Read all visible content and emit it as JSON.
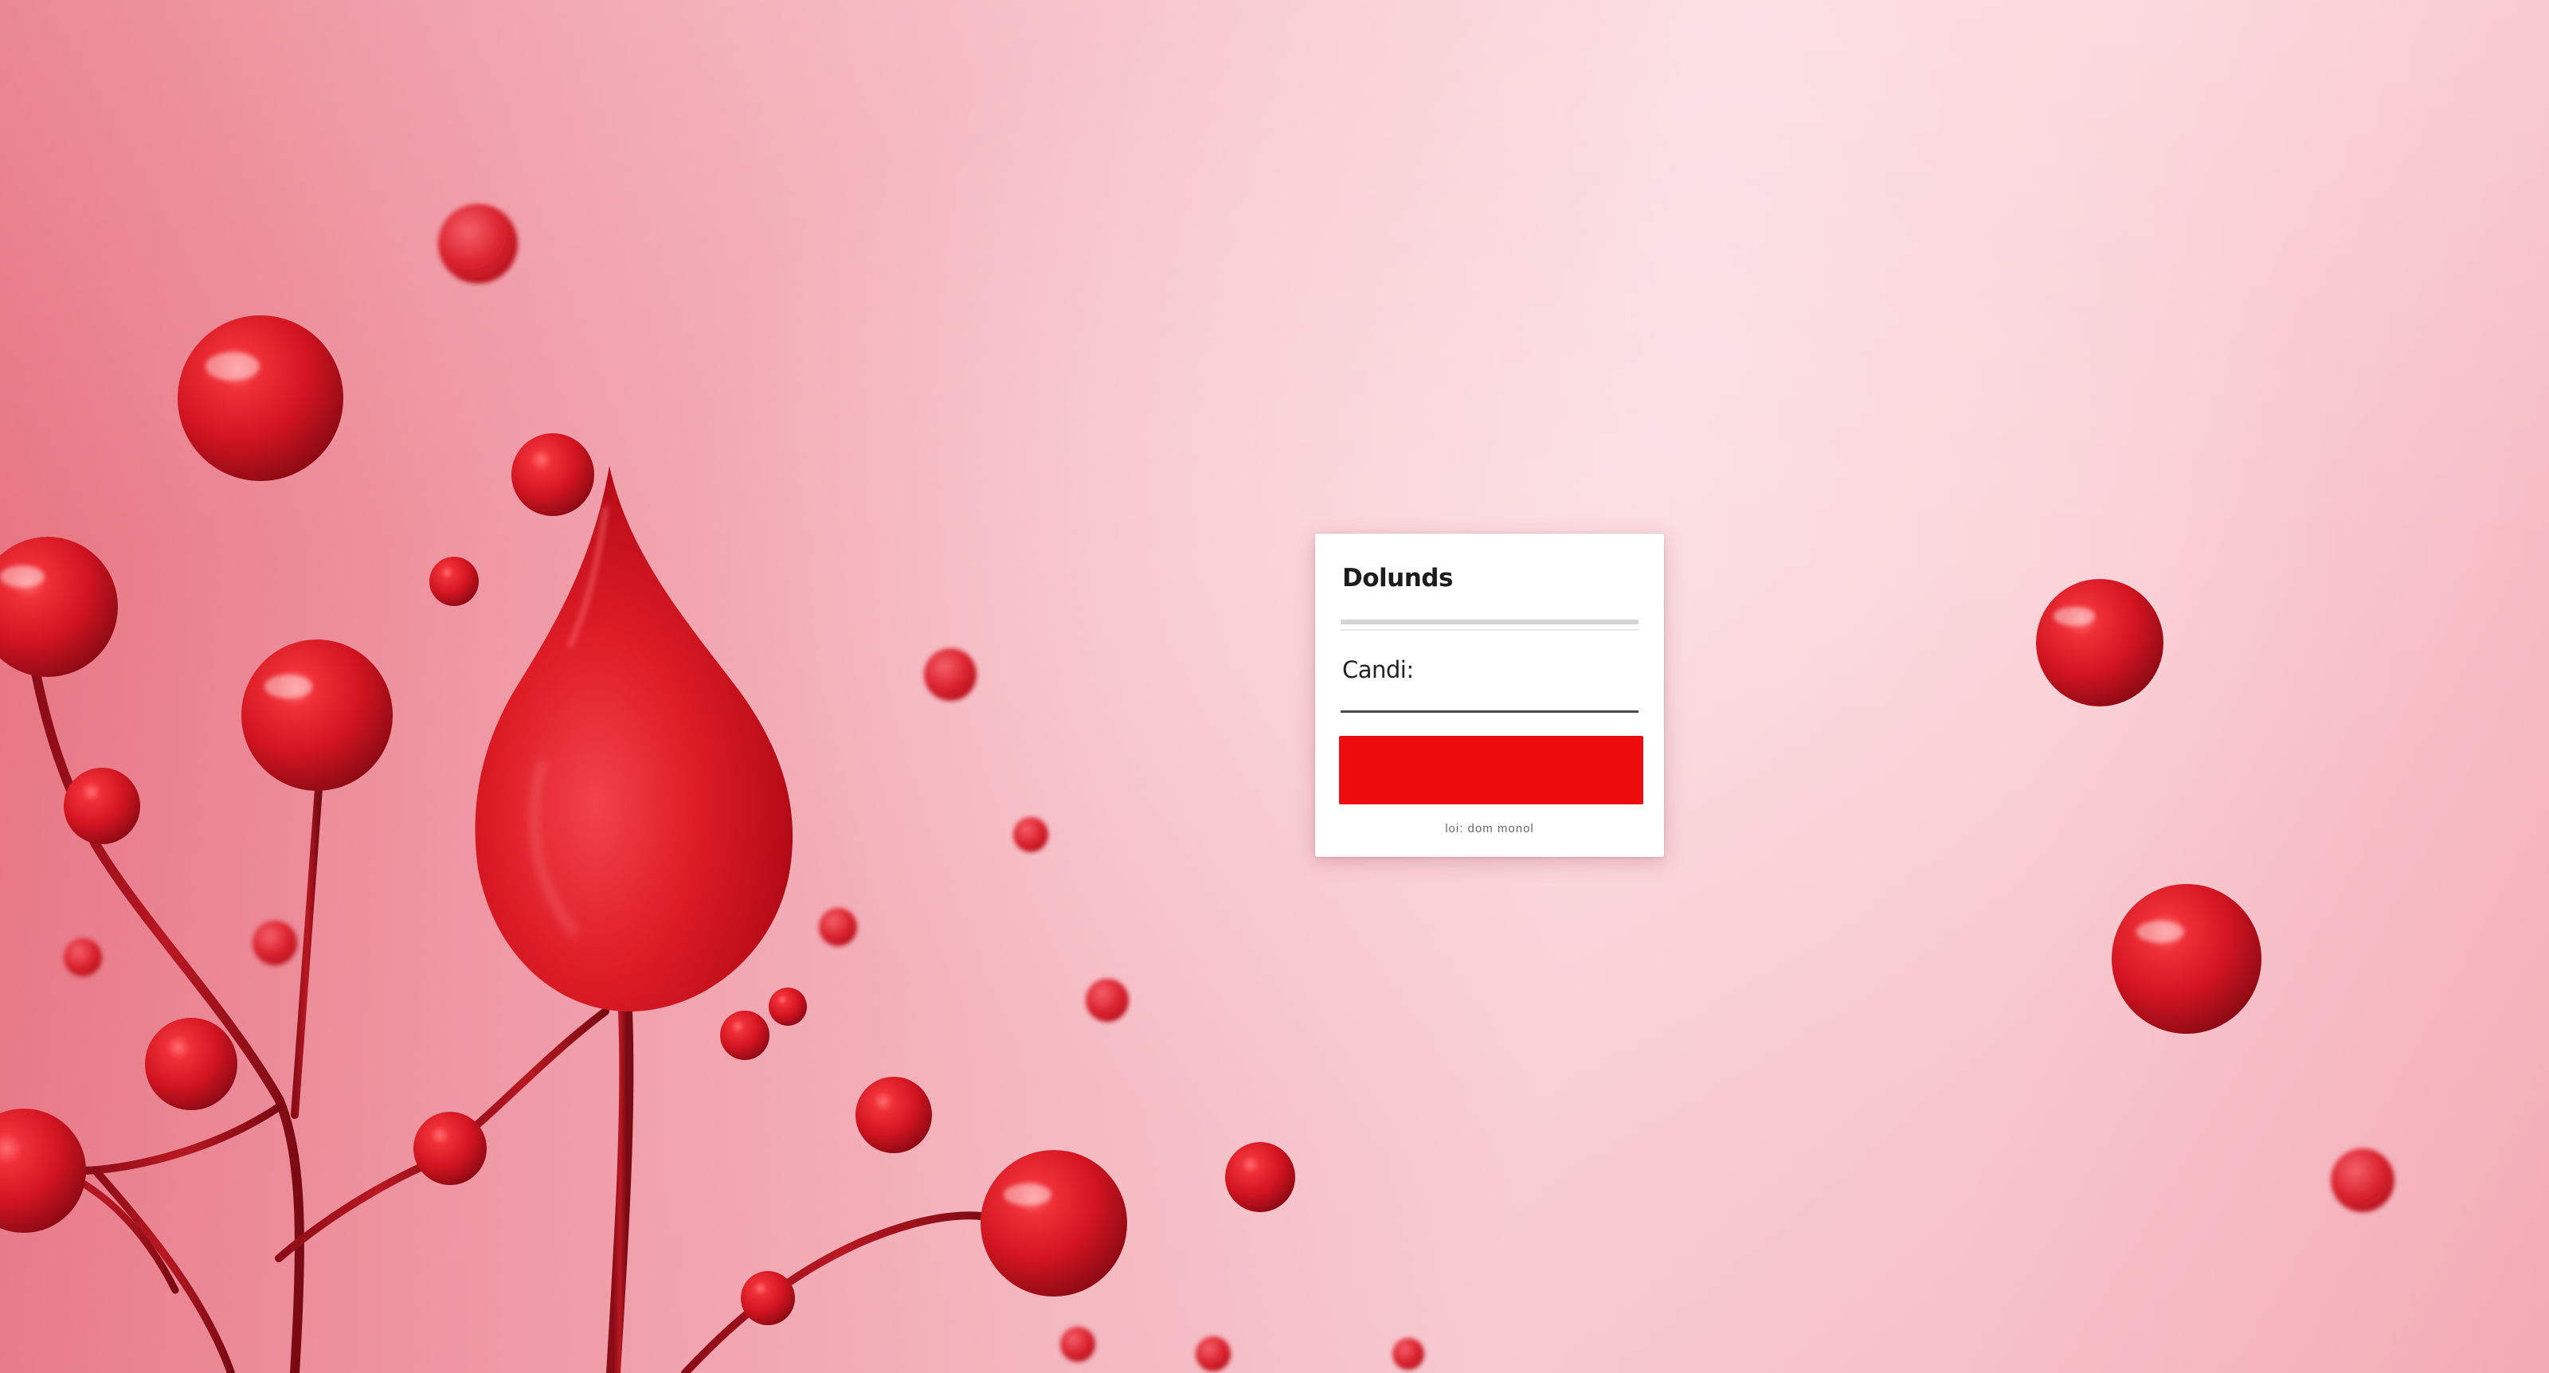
{
  "login_form": {
    "field_1_label": "Dolunds",
    "field_2_label": "Candi:",
    "field_1_value": "",
    "field_2_value": "",
    "submit_label": "",
    "footer_text": "loi: dom monol"
  },
  "colors": {
    "accent": "#ec0c0e",
    "card_background": "#ffffff",
    "background_light": "#fbd9de",
    "background_dark": "#e66f7d",
    "blood_red": "#d8141e"
  },
  "decoration": {
    "motif": "blood-drop-and-cells"
  }
}
